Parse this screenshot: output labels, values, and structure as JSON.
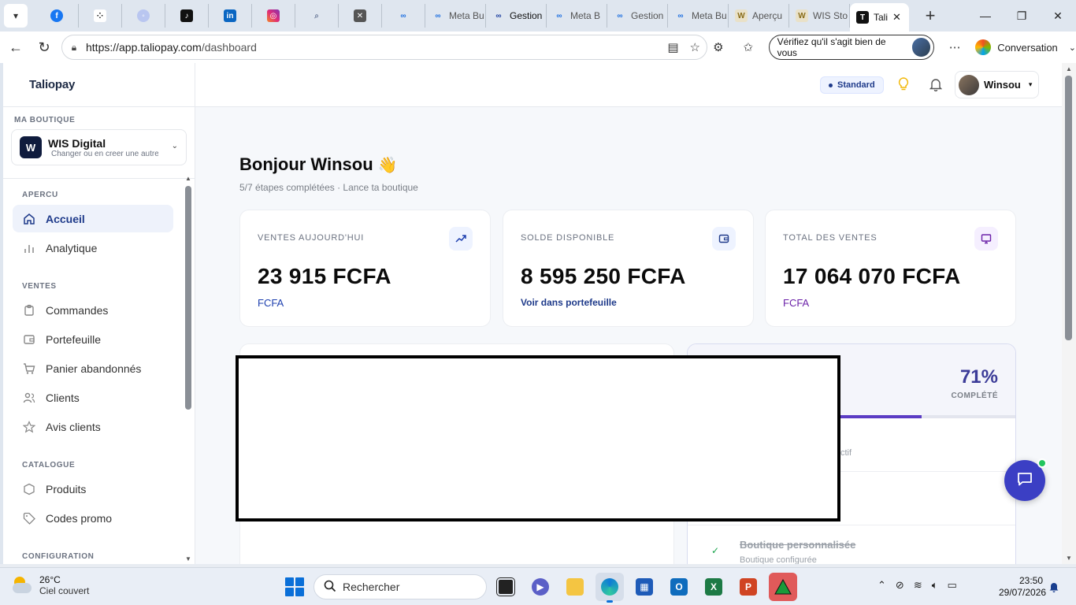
{
  "browser": {
    "tabs": [
      {
        "icon": "facebook-icon",
        "label": ""
      },
      {
        "icon": "threads-dots-icon",
        "label": ""
      },
      {
        "icon": "messenger-icon",
        "label": ""
      },
      {
        "icon": "tiktok-icon",
        "label": ""
      },
      {
        "icon": "linkedin-icon",
        "label": ""
      },
      {
        "icon": "instagram-icon",
        "label": ""
      },
      {
        "icon": "search-icon",
        "label": ""
      },
      {
        "icon": "x-icon",
        "label": ""
      },
      {
        "icon": "meta-icon",
        "label": ""
      },
      {
        "icon": "meta-icon",
        "label": "Meta Bu"
      },
      {
        "icon": "meta-icon",
        "label": "Gestion"
      },
      {
        "icon": "meta-icon",
        "label": "Meta B"
      },
      {
        "icon": "meta-icon",
        "label": "Gestion"
      },
      {
        "icon": "meta-icon",
        "label": "Meta Bu"
      },
      {
        "icon": "wis-icon",
        "label": "Aperçu"
      },
      {
        "icon": "wis-icon",
        "label": "WIS Sto"
      }
    ],
    "active_tab": {
      "label": "Tali"
    },
    "url_host": "https://app.taliopay.com",
    "url_path": "/dashboard",
    "verify_label": "Vérifiez qu'il s'agit bien de vous",
    "copilot_label": "Conversation"
  },
  "sidebar": {
    "logo": "Taliopay",
    "shop_section": "MA BOUTIQUE",
    "shop_name": "WIS Digital",
    "shop_initial": "W",
    "shop_sub": "Changer ou en creer une autre",
    "sections": {
      "apercu": "APERCU",
      "ventes": "VENTES",
      "catalogue": "CATALOGUE",
      "configuration": "CONFIGURATION"
    },
    "items": {
      "accueil": "Accueil",
      "analytique": "Analytique",
      "commandes": "Commandes",
      "portefeuille": "Portefeuille",
      "panier": "Panier abandonnés",
      "clients": "Clients",
      "avis": "Avis clients",
      "produits": "Produits",
      "codes": "Codes promo"
    }
  },
  "topbar": {
    "plan": "Standard",
    "user_name": "Winsou"
  },
  "main": {
    "greeting": "Bonjour Winsou",
    "wave": "👋",
    "steps_progress": "5/7 étapes complétées",
    "steps_hint": "Lance ta boutique",
    "stats": [
      {
        "label": "VENTES AUJOURD'HUI",
        "value": "23 915 FCFA",
        "sub": "FCFA",
        "icon": "trending-up-icon",
        "accent": "#1e40af",
        "icon_bg": "#eef3ff"
      },
      {
        "label": "SOLDE DISPONIBLE",
        "value": "8 595 250 FCFA",
        "sub": "Voir dans portefeuille",
        "icon": "wallet-icon",
        "accent": "#1e3a8a",
        "icon_bg": "#eef3ff"
      },
      {
        "label": "TOTAL DES VENTES",
        "value": "17 064 070 FCFA",
        "sub": "FCFA",
        "icon": "monitor-icon",
        "accent": "#6b21a8",
        "icon_bg": "#f5efff"
      }
    ],
    "onboarding": {
      "percent": "71%",
      "percent_value": 0.71,
      "percent_label": "COMPLÉTÉ",
      "partial_desc": "ctif",
      "step_title": "Boutique personnalisée",
      "step_desc": "Boutique configurée"
    }
  },
  "taskbar": {
    "temp": "26°C",
    "weather": "Ciel couvert",
    "search": "Rechercher",
    "time": "23:50",
    "date": "29/07/2026"
  },
  "colors": {
    "brand": "#1e3a8a",
    "chat_fab": "#3b3fc4",
    "progress_fill": "#5b3cc4"
  }
}
